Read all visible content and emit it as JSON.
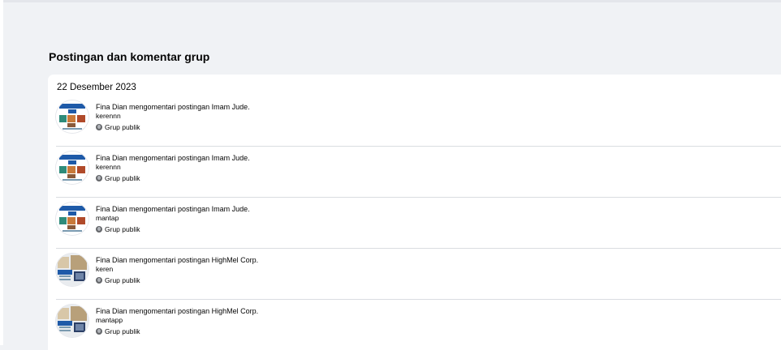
{
  "section": {
    "title": "Postingan dan komentar grup"
  },
  "date_header": "22 Desember 2023",
  "items": [
    {
      "action": "Fina Dian mengomentari postingan Imam Jude.",
      "comment": "kerennn",
      "privacy": "Grup publik",
      "avatar_icon": "group-poster-avatar-icon"
    },
    {
      "action": "Fina Dian mengomentari postingan Imam Jude.",
      "comment": "kerennn",
      "privacy": "Grup publik",
      "avatar_icon": "group-poster-avatar-icon"
    },
    {
      "action": "Fina Dian mengomentari postingan Imam Jude.",
      "comment": "mantap",
      "privacy": "Grup publik",
      "avatar_icon": "group-poster-avatar-icon"
    },
    {
      "action": "Fina Dian mengomentari postingan HighMel Corp.",
      "comment": "keren",
      "privacy": "Grup publik",
      "avatar_icon": "company-avatar-icon"
    },
    {
      "action": "Fina Dian mengomentari postingan HighMel Corp.",
      "comment": "mantapp",
      "privacy": "Grup publik",
      "avatar_icon": "company-avatar-icon"
    }
  ],
  "colors": {
    "background": "#f0f2f5",
    "card": "#ffffff",
    "text": "#050505",
    "divider": "#dadde1",
    "icon": "#65676b"
  }
}
